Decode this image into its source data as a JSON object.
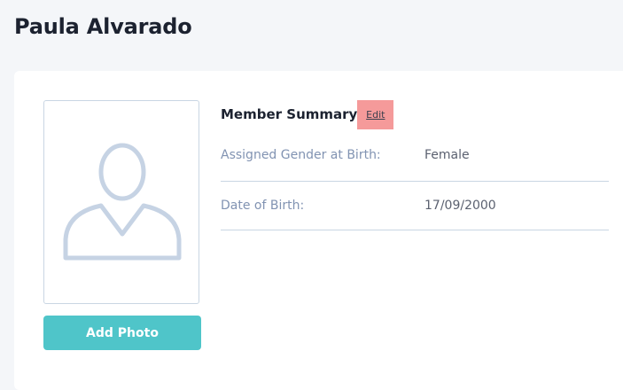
{
  "page": {
    "title": "Paula Alvarado"
  },
  "photo": {
    "add_button_label": "Add Photo",
    "placeholder_icon": "user-silhouette-icon"
  },
  "summary": {
    "title": "Member Summary",
    "edit_label": "Edit",
    "rows": [
      {
        "label": "Assigned Gender at Birth:",
        "value": "Female"
      },
      {
        "label": "Date of Birth:",
        "value": "17/09/2000"
      }
    ]
  },
  "colors": {
    "accent": "#4fc5c9",
    "edit_highlight": "#f59a9a",
    "label_text": "#8193b2",
    "divider": "#c9d6e3"
  }
}
